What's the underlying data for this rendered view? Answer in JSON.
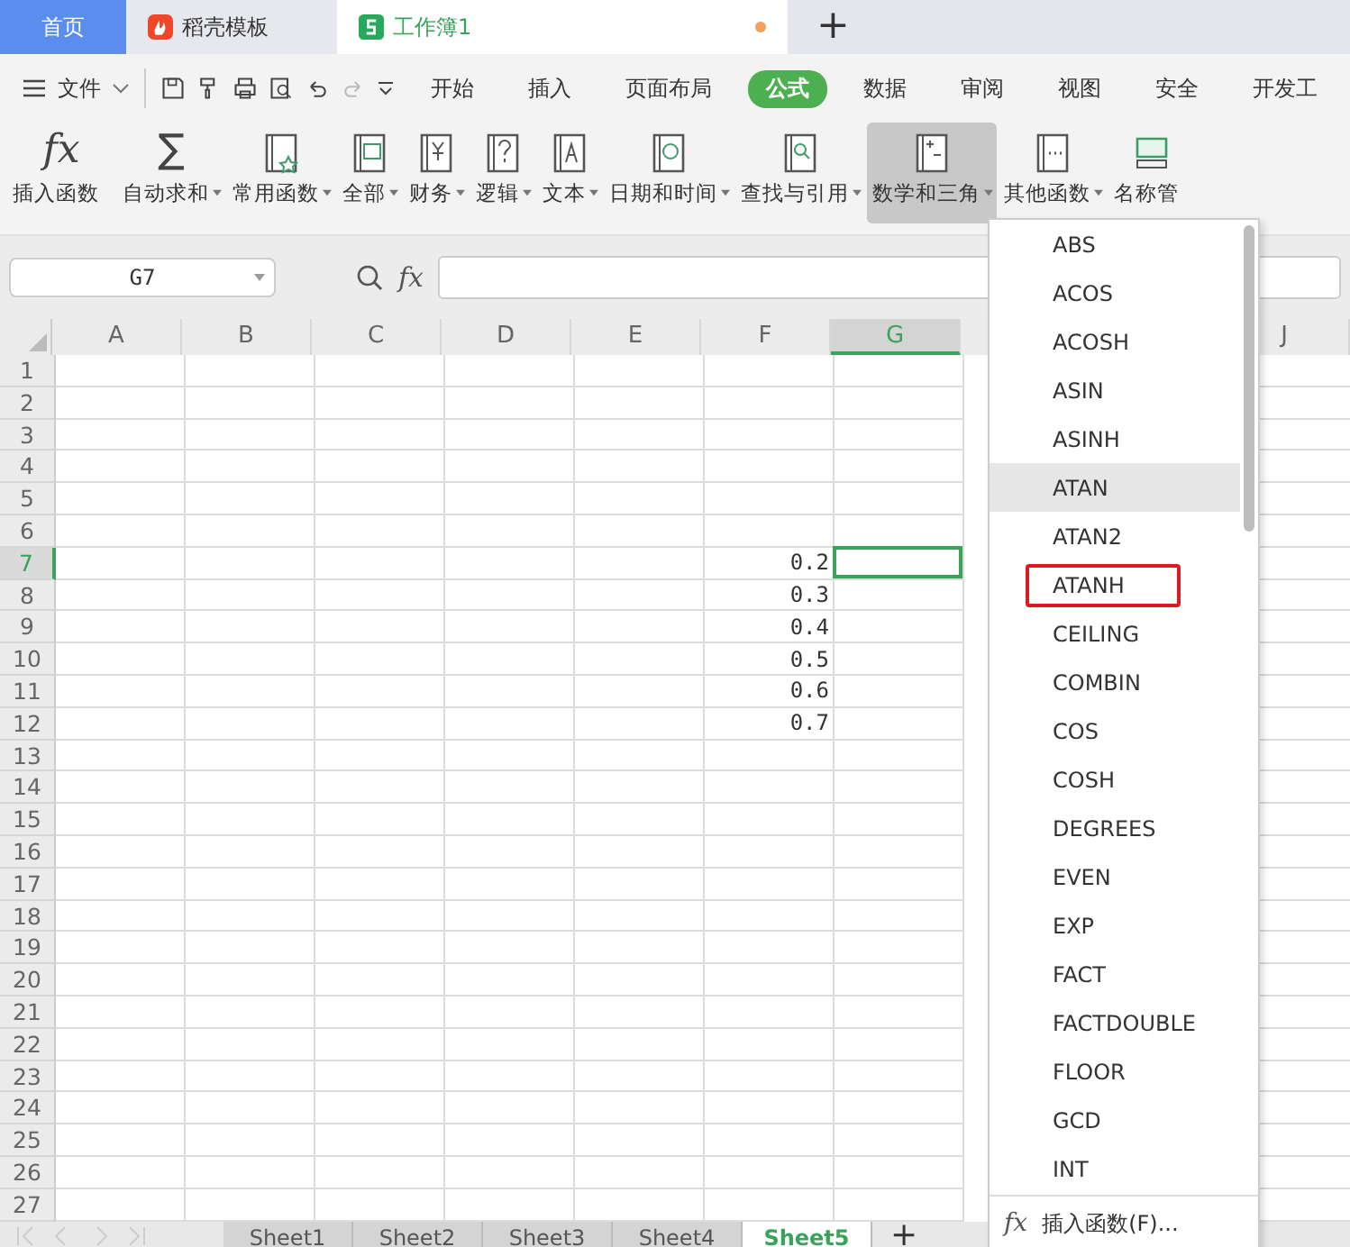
{
  "tabs": [
    {
      "label": "首页",
      "kind": "home",
      "selected": false
    },
    {
      "label": "稻壳模板",
      "kind": "docer",
      "selected": false
    },
    {
      "label": "工作簿1",
      "kind": "sheet",
      "selected": true,
      "modified": true
    }
  ],
  "new_tab": "+",
  "menu": {
    "file": "文件",
    "items": [
      {
        "label": "开始",
        "selected": false
      },
      {
        "label": "插入",
        "selected": false
      },
      {
        "label": "页面布局",
        "selected": false
      },
      {
        "label": "公式",
        "selected": true
      },
      {
        "label": "数据",
        "selected": false
      },
      {
        "label": "审阅",
        "selected": false
      },
      {
        "label": "视图",
        "selected": false
      },
      {
        "label": "安全",
        "selected": false
      },
      {
        "label": "开发工",
        "selected": false
      }
    ]
  },
  "ribbon": [
    {
      "label": "插入函数",
      "kind": "fx",
      "glyph": "fx",
      "dropdown": false,
      "selected": false
    },
    {
      "label": "自动求和",
      "kind": "sigma",
      "glyph": "∑",
      "dropdown": true,
      "selected": false
    },
    {
      "label": "常用函数",
      "kind": "star",
      "dropdown": true,
      "selected": false
    },
    {
      "label": "全部",
      "kind": "fxbook",
      "dropdown": true,
      "selected": false
    },
    {
      "label": "财务",
      "kind": "yen",
      "dropdown": true,
      "selected": false
    },
    {
      "label": "逻辑",
      "kind": "question",
      "dropdown": true,
      "selected": false
    },
    {
      "label": "文本",
      "kind": "letter",
      "dropdown": true,
      "selected": false
    },
    {
      "label": "日期和时间",
      "kind": "clock",
      "dropdown": true,
      "selected": false
    },
    {
      "label": "查找与引用",
      "kind": "lens",
      "dropdown": true,
      "selected": false
    },
    {
      "label": "数学和三角",
      "kind": "plusminus",
      "dropdown": true,
      "selected": true
    },
    {
      "label": "其他函数",
      "kind": "dots",
      "dropdown": true,
      "selected": false
    },
    {
      "label": "名称管",
      "kind": "names",
      "dropdown": false,
      "selected": false
    }
  ],
  "formula_bar": {
    "name_box": "G7",
    "fx": "fx"
  },
  "columns": [
    {
      "label": "A",
      "selected": false
    },
    {
      "label": "B",
      "selected": false
    },
    {
      "label": "C",
      "selected": false
    },
    {
      "label": "D",
      "selected": false
    },
    {
      "label": "E",
      "selected": false
    },
    {
      "label": "F",
      "selected": false
    },
    {
      "label": "G",
      "selected": true
    },
    {
      "label": "J",
      "selected": false
    }
  ],
  "rows": [
    {
      "label": "1",
      "selected": false
    },
    {
      "label": "2",
      "selected": false
    },
    {
      "label": "3",
      "selected": false
    },
    {
      "label": "4",
      "selected": false
    },
    {
      "label": "5",
      "selected": false
    },
    {
      "label": "6",
      "selected": false
    },
    {
      "label": "7",
      "selected": true,
      "f": "0.2"
    },
    {
      "label": "8",
      "selected": false,
      "f": "0.3"
    },
    {
      "label": "9",
      "selected": false,
      "f": "0.4"
    },
    {
      "label": "10",
      "selected": false,
      "f": "0.5"
    },
    {
      "label": "11",
      "selected": false,
      "f": "0.6"
    },
    {
      "label": "12",
      "selected": false,
      "f": "0.7"
    },
    {
      "label": "13",
      "selected": false
    },
    {
      "label": "14",
      "selected": false
    },
    {
      "label": "15",
      "selected": false
    },
    {
      "label": "16",
      "selected": false
    },
    {
      "label": "17",
      "selected": false
    },
    {
      "label": "18",
      "selected": false
    },
    {
      "label": "19",
      "selected": false
    },
    {
      "label": "20",
      "selected": false
    },
    {
      "label": "21",
      "selected": false
    },
    {
      "label": "22",
      "selected": false
    },
    {
      "label": "23",
      "selected": false
    },
    {
      "label": "24",
      "selected": false
    },
    {
      "label": "25",
      "selected": false
    },
    {
      "label": "26",
      "selected": false
    },
    {
      "label": "27",
      "selected": false
    }
  ],
  "function_menu": {
    "items": [
      {
        "label": "ABS",
        "highlighted": false,
        "annotated": false
      },
      {
        "label": "ACOS",
        "highlighted": false,
        "annotated": false
      },
      {
        "label": "ACOSH",
        "highlighted": false,
        "annotated": false
      },
      {
        "label": "ASIN",
        "highlighted": false,
        "annotated": false
      },
      {
        "label": "ASINH",
        "highlighted": false,
        "annotated": false
      },
      {
        "label": "ATAN",
        "highlighted": true,
        "annotated": false
      },
      {
        "label": "ATAN2",
        "highlighted": false,
        "annotated": false
      },
      {
        "label": "ATANH",
        "highlighted": false,
        "annotated": true
      },
      {
        "label": "CEILING",
        "highlighted": false,
        "annotated": false
      },
      {
        "label": "COMBIN",
        "highlighted": false,
        "annotated": false
      },
      {
        "label": "COS",
        "highlighted": false,
        "annotated": false
      },
      {
        "label": "COSH",
        "highlighted": false,
        "annotated": false
      },
      {
        "label": "DEGREES",
        "highlighted": false,
        "annotated": false
      },
      {
        "label": "EVEN",
        "highlighted": false,
        "annotated": false
      },
      {
        "label": "EXP",
        "highlighted": false,
        "annotated": false
      },
      {
        "label": "FACT",
        "highlighted": false,
        "annotated": false
      },
      {
        "label": "FACTDOUBLE",
        "highlighted": false,
        "annotated": false
      },
      {
        "label": "FLOOR",
        "highlighted": false,
        "annotated": false
      },
      {
        "label": "GCD",
        "highlighted": false,
        "annotated": false
      },
      {
        "label": "INT",
        "highlighted": false,
        "annotated": false
      }
    ],
    "footer": {
      "icon": "fx",
      "label": "插入函数(F)..."
    }
  },
  "sheets": [
    {
      "label": "Sheet1",
      "selected": false
    },
    {
      "label": "Sheet2",
      "selected": false
    },
    {
      "label": "Sheet3",
      "selected": false
    },
    {
      "label": "Sheet4",
      "selected": false
    },
    {
      "label": "Sheet5",
      "selected": true
    }
  ],
  "add_sheet": "+"
}
